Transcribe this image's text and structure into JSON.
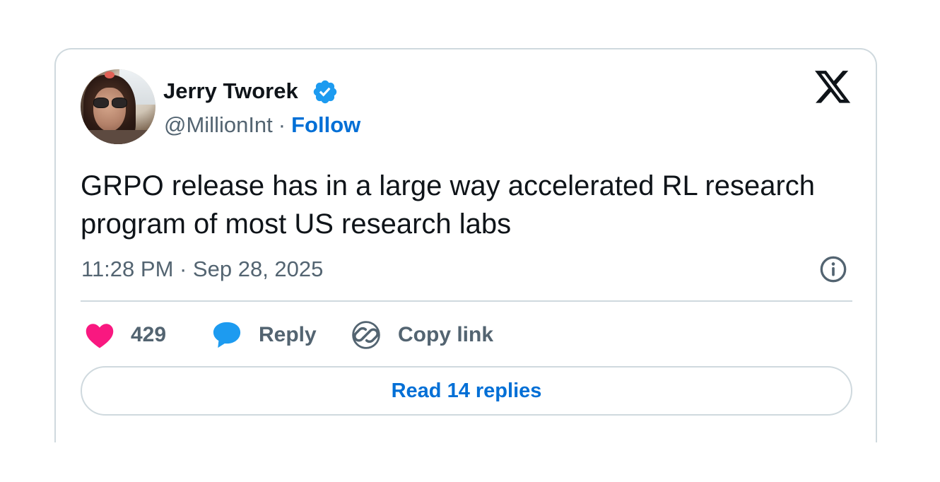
{
  "author": {
    "name": "Jerry Tworek",
    "handle": "@MillionInt",
    "separator": "·",
    "follow_label": "Follow",
    "verified": true
  },
  "tweet": {
    "text": "GRPO release has in a large way accelerated RL research program of most US research labs",
    "timestamp": "11:28 PM · Sep 28, 2025"
  },
  "actions": {
    "like_count": "429",
    "reply_label": "Reply",
    "copy_link_label": "Copy link"
  },
  "read_replies_label": "Read 14 replies",
  "icons": {
    "verified": "verified-badge-icon",
    "platform": "x-logo-icon",
    "info": "info-icon",
    "like": "heart-icon",
    "reply": "speech-bubble-icon",
    "copy": "link-icon"
  },
  "colors": {
    "text_primary": "#0f1419",
    "text_secondary": "#536471",
    "link": "#006fd6",
    "verified": "#1d9bf0",
    "heart": "#f91880",
    "reply": "#1d9bf0",
    "border": "#cfd9de"
  }
}
